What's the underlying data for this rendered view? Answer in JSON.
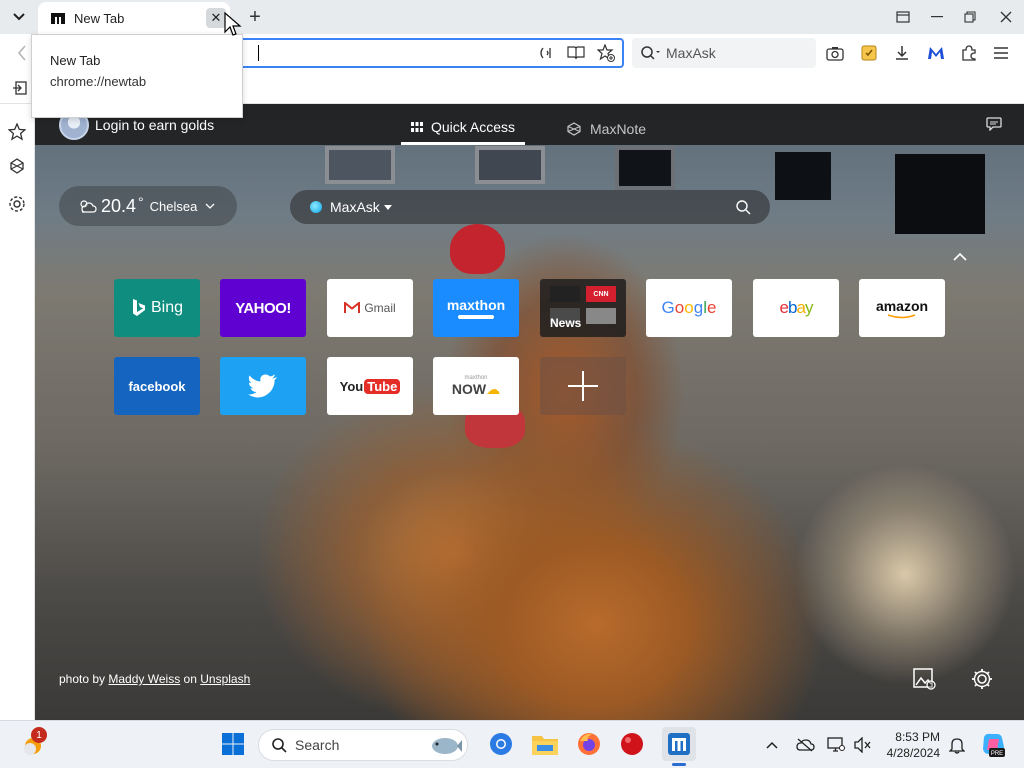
{
  "tab": {
    "title": "New Tab",
    "close_glyph": "✕",
    "new_tab_glyph": "+"
  },
  "tooltip": {
    "title": "New Tab",
    "url": "chrome://newtab"
  },
  "toolbar": {
    "search_placeholder": "MaxAsk"
  },
  "page": {
    "login_text": "Login to earn golds",
    "nav_tabs": [
      {
        "label": "Quick Access",
        "active": true,
        "icon": "grid-icon"
      },
      {
        "label": "MaxNote",
        "active": false,
        "icon": "maxnote-icon"
      }
    ],
    "weather": {
      "temperature": "20.4",
      "unit": "°",
      "location": "Chelsea"
    },
    "search_engine": "MaxAsk",
    "tiles_row1": [
      {
        "label": "Bing",
        "bg": "#0f8d7e",
        "color": "#ffffff"
      },
      {
        "label": "YAHOO!",
        "bg": "#5f01d1",
        "color": "#ffffff"
      },
      {
        "label": "Gmail",
        "bg": "#ffffff",
        "color": "#555555"
      },
      {
        "label": "maxthon",
        "bg": "#1a8cff",
        "color": "#ffffff"
      },
      {
        "label": "News",
        "bg": "rgba(30,30,30,0.85)",
        "color": "#ffffff"
      },
      {
        "label": "Google",
        "bg": "#ffffff",
        "color": "#4285f4"
      },
      {
        "label": "ebay",
        "bg": "#ffffff",
        "color": "#e53238"
      },
      {
        "label": "amazon",
        "bg": "#ffffff",
        "color": "#111111"
      }
    ],
    "tiles_row2": [
      {
        "label": "facebook",
        "bg": "#1565c0",
        "color": "#ffffff"
      },
      {
        "label": "twitter",
        "bg": "#1da1f2",
        "color": "#ffffff"
      },
      {
        "label": "YouTube",
        "bg": "#ffffff",
        "color": "#222222"
      },
      {
        "label": "NOW",
        "bg": "#ffffff",
        "color": "#444444"
      },
      {
        "label": "add",
        "bg": "rgba(110,80,70,0.55)",
        "color": "#ffffff"
      }
    ],
    "news_sub": [
      "CNN"
    ],
    "credit": {
      "prefix": "photo by",
      "author": "Maddy Weiss",
      "middle": "on",
      "source": "Unsplash"
    }
  },
  "taskbar": {
    "search_label": "Search",
    "notification_count": "1",
    "time": "8:53 PM",
    "date": "4/28/2024"
  }
}
